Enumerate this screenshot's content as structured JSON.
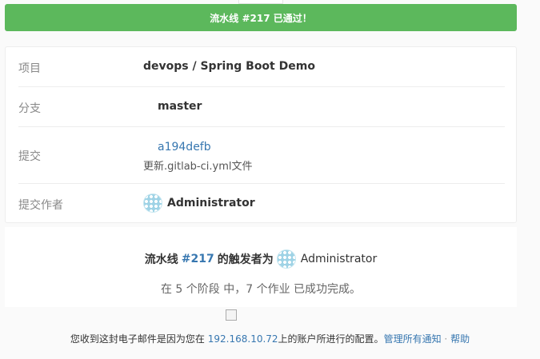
{
  "banner": {
    "text": "流水线 #217 已通过！"
  },
  "info": {
    "project_label": "项目",
    "project_value": "devops / Spring Boot Demo",
    "branch_label": "分支",
    "branch_value": "master",
    "commit_label": "提交",
    "commit_sha": "a194defb",
    "commit_message": "更新.gitlab-ci.yml文件",
    "author_label": "提交作者",
    "author_name": "Administrator"
  },
  "summary": {
    "trigger_prefix": "流水线",
    "pipeline_id": "#217",
    "trigger_middle": "的触发者为",
    "trigger_user": "Administrator",
    "stages_text": "在 5 个阶段 中，7 个作业 已成功完成。"
  },
  "footer": {
    "prefix": "您收到这封电子邮件是因为您在",
    "host": "192.168.10.72",
    "suffix": "上的账户所进行的配置。",
    "manage_link": "管理所有通知",
    "separator": "·",
    "help_link": "帮助"
  }
}
